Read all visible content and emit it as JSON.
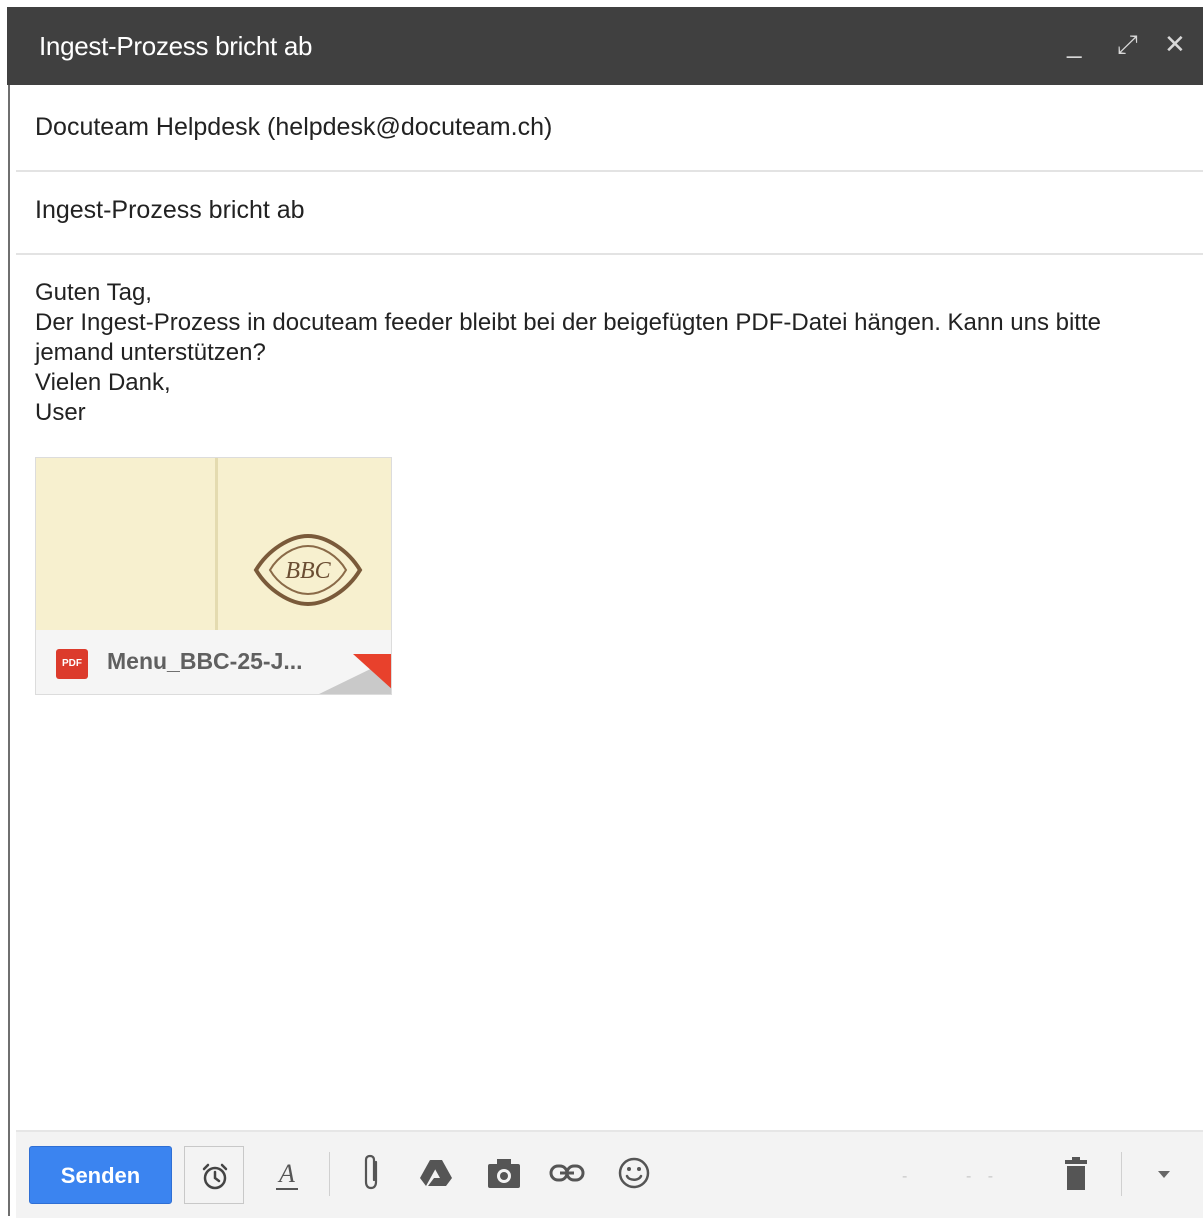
{
  "window": {
    "title": "Ingest-Prozess bricht ab"
  },
  "title_controls": {
    "minimize": "_",
    "maximize": "⤢",
    "close": "✕"
  },
  "recipient": "Docuteam Helpdesk (helpdesk@docuteam.ch)",
  "subject": "Ingest-Prozess bricht ab",
  "body": {
    "lines": [
      "Guten Tag,",
      "Der Ingest-Prozess in docuteam feeder bleibt bei der beigefügten PDF-Datei hängen. Kann uns bitte",
      "jemand unterstützen?",
      "Vielen Dank,",
      "User"
    ]
  },
  "attachment": {
    "filename": "Menu_BBC-25-J...",
    "type_badge": "PDF",
    "thumbnail_text": "BBC"
  },
  "toolbar": {
    "send_label": "Senden",
    "icons": [
      "alarm-clock-icon",
      "text-format-icon",
      "attach-icon",
      "drive-icon",
      "camera-icon",
      "link-icon",
      "emoji-icon",
      "trash-icon",
      "chevron-down-icon"
    ]
  }
}
